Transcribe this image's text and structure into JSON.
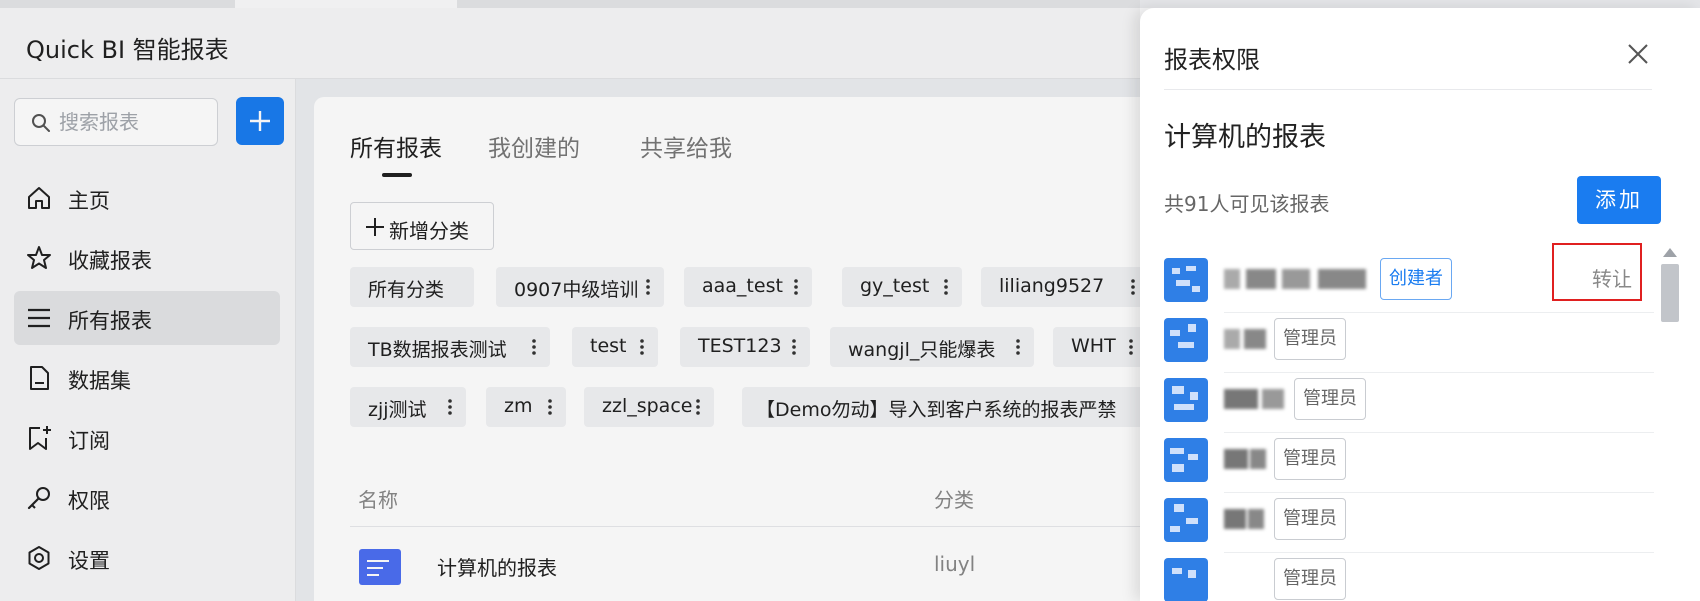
{
  "app": {
    "title": "Quick BI 智能报表"
  },
  "sidebar": {
    "search_placeholder": "搜索报表",
    "items": [
      {
        "label": "主页",
        "icon": "home-icon"
      },
      {
        "label": "收藏报表",
        "icon": "star-icon"
      },
      {
        "label": "所有报表",
        "icon": "list-icon",
        "active": true
      },
      {
        "label": "数据集",
        "icon": "document-icon"
      },
      {
        "label": "订阅",
        "icon": "bookmark-plus-icon"
      },
      {
        "label": "权限",
        "icon": "key-icon"
      },
      {
        "label": "设置",
        "icon": "settings-icon"
      }
    ]
  },
  "main": {
    "tabs": [
      "所有报表",
      "我创建的",
      "共享给我"
    ],
    "active_tab": 0,
    "new_category_label": "新增分类",
    "categories": [
      "所有分类",
      "0907中级培训",
      "aaa_test",
      "gy_test",
      "liliang9527",
      "TB数据报表测试",
      "test",
      "TEST123",
      "wangjl_只能爆表",
      "WHT",
      "zjj测试",
      "zm",
      "zzl_space",
      "【Demo勿动】导入到客户系统的报表严禁"
    ],
    "table": {
      "headers": {
        "name": "名称",
        "category": "分类"
      },
      "rows": [
        {
          "name": "计算机的报表",
          "category": "liuyl"
        }
      ]
    }
  },
  "drawer": {
    "title": "报表权限",
    "report_name": "计算机的报表",
    "visible_count_text": "共91人可见该报表",
    "add_label": "添加",
    "users": [
      {
        "role": "创建者",
        "action": "转让"
      },
      {
        "role": "管理员"
      },
      {
        "role": "管理员"
      },
      {
        "role": "管理员"
      },
      {
        "role": "管理员"
      },
      {
        "role": "管理员"
      }
    ]
  },
  "colors": {
    "accent": "#1a7cf0",
    "report_icon": "#4d6ff2",
    "highlight": "#e02020"
  }
}
